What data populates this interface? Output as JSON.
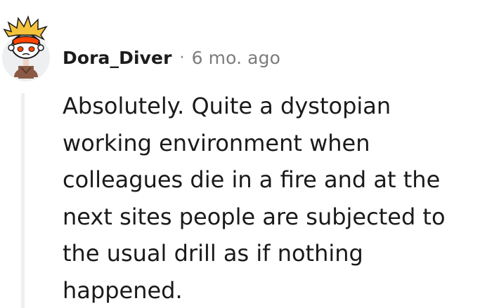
{
  "comment": {
    "author": "Dora_Diver",
    "separator": "·",
    "timestamp": "6 mo. ago",
    "body_lines": [
      "Absolutely. Quite a dystopian",
      "working environment when",
      "colleagues die in a fire and at the",
      "next sites people are subjected to",
      "the usual drill as if nothing",
      "happened."
    ]
  },
  "colors": {
    "author": "#1c1c1c",
    "meta": "#7c7c7c",
    "body": "#1a1a1b",
    "thread_line": "#edeff1",
    "avatar_hair": "#f5c23b",
    "avatar_visor": "#ff4500"
  },
  "icons": {
    "avatar": "snoo-avatar-icon"
  }
}
